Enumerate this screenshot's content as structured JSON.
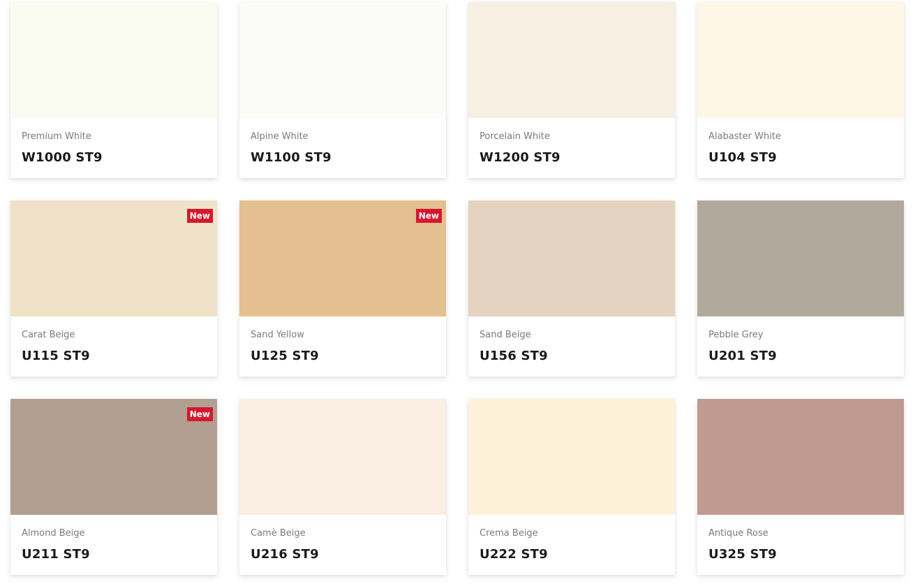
{
  "new_label": "New",
  "colors": [
    {
      "name": "Premium White",
      "code": "W1000 ST9",
      "swatch": "#fafcf2",
      "is_new": false
    },
    {
      "name": "Alpine White",
      "code": "W1100 ST9",
      "swatch": "#fbfbf8",
      "is_new": false
    },
    {
      "name": "Porcelain White",
      "code": "W1200 ST9",
      "swatch": "#f6efe2",
      "is_new": false
    },
    {
      "name": "Alabaster White",
      "code": "U104 ST9",
      "swatch": "#fff7e5",
      "is_new": false
    },
    {
      "name": "Carat Beige",
      "code": "U115 ST9",
      "swatch": "#f0e2c8",
      "is_new": true
    },
    {
      "name": "Sand Yellow",
      "code": "U125 ST9",
      "swatch": "#e4bf90",
      "is_new": true
    },
    {
      "name": "Sand Beige",
      "code": "U156 ST9",
      "swatch": "#e4d3c0",
      "is_new": false
    },
    {
      "name": "Pebble Grey",
      "code": "U201 ST9",
      "swatch": "#b1a99c",
      "is_new": false
    },
    {
      "name": "Almond Beige",
      "code": "U211 ST9",
      "swatch": "#b29f91",
      "is_new": true
    },
    {
      "name": "Camè Beige",
      "code": "U216 ST9",
      "swatch": "#fbeee2",
      "is_new": false
    },
    {
      "name": "Crema Beige",
      "code": "U222 ST9",
      "swatch": "#fdf1da",
      "is_new": false
    },
    {
      "name": "Antique Rose",
      "code": "U325 ST9",
      "swatch": "#bf9a90",
      "is_new": false
    }
  ]
}
